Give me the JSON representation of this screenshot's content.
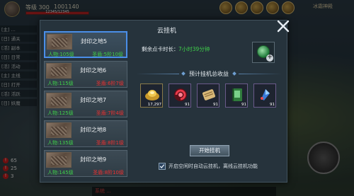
{
  "hud": {
    "level": "等级 300",
    "gold": "1001140",
    "hp_text": "12345/12345",
    "hp_fraction": 1.0,
    "map": "冰霜神殿",
    "left_rows": [
      {
        "text": "[主] ..."
      },
      {
        "text": "[日] 通关"
      },
      {
        "text": "[活] 副本"
      },
      {
        "text": "[日] 日常"
      },
      {
        "text": "[活] 活动"
      },
      {
        "text": "[主] 主线"
      },
      {
        "text": "[日] 打开"
      },
      {
        "text": "[活] 活跃"
      },
      {
        "text": "[日] 妖魔"
      }
    ],
    "alerts": [
      {
        "count": "65"
      },
      {
        "count": "25"
      },
      {
        "count": "3"
      }
    ],
    "chat": "系统 ..."
  },
  "modal": {
    "title": "云挂机",
    "remaining_label": "剩余点卡时长：",
    "remaining_value": "7小时39分钟",
    "section_title": "预计挂机总收益",
    "start_button": "开始挂机",
    "auto_label": "开启空闲时自动云挂机，离线云挂机功能",
    "auto_checked": true,
    "list": [
      {
        "name": "封印之地5",
        "people": "人物:105级",
        "req": "圣盾:5阶10级",
        "active": true
      },
      {
        "name": "封印之地6",
        "people": "人物:115级",
        "req": "圣盾:6阶7级",
        "active": false
      },
      {
        "name": "封印之地7",
        "people": "人物:125级",
        "req": "圣盾:7阶4级",
        "active": false
      },
      {
        "name": "封印之地8",
        "people": "人物:135级",
        "req": "圣盾:8阶1级",
        "active": false
      },
      {
        "name": "封印之地9",
        "people": "人物:145级",
        "req": "圣盾:8阶10级",
        "active": false
      }
    ],
    "rewards": [
      {
        "icon": "gold-ingot-icon",
        "count": "17,297"
      },
      {
        "icon": "red-gem-icon",
        "count": "91"
      },
      {
        "icon": "scroll-icon",
        "count": "91"
      },
      {
        "icon": "green-book-icon",
        "count": "91"
      },
      {
        "icon": "blue-crystal-icon",
        "count": "91"
      }
    ]
  }
}
